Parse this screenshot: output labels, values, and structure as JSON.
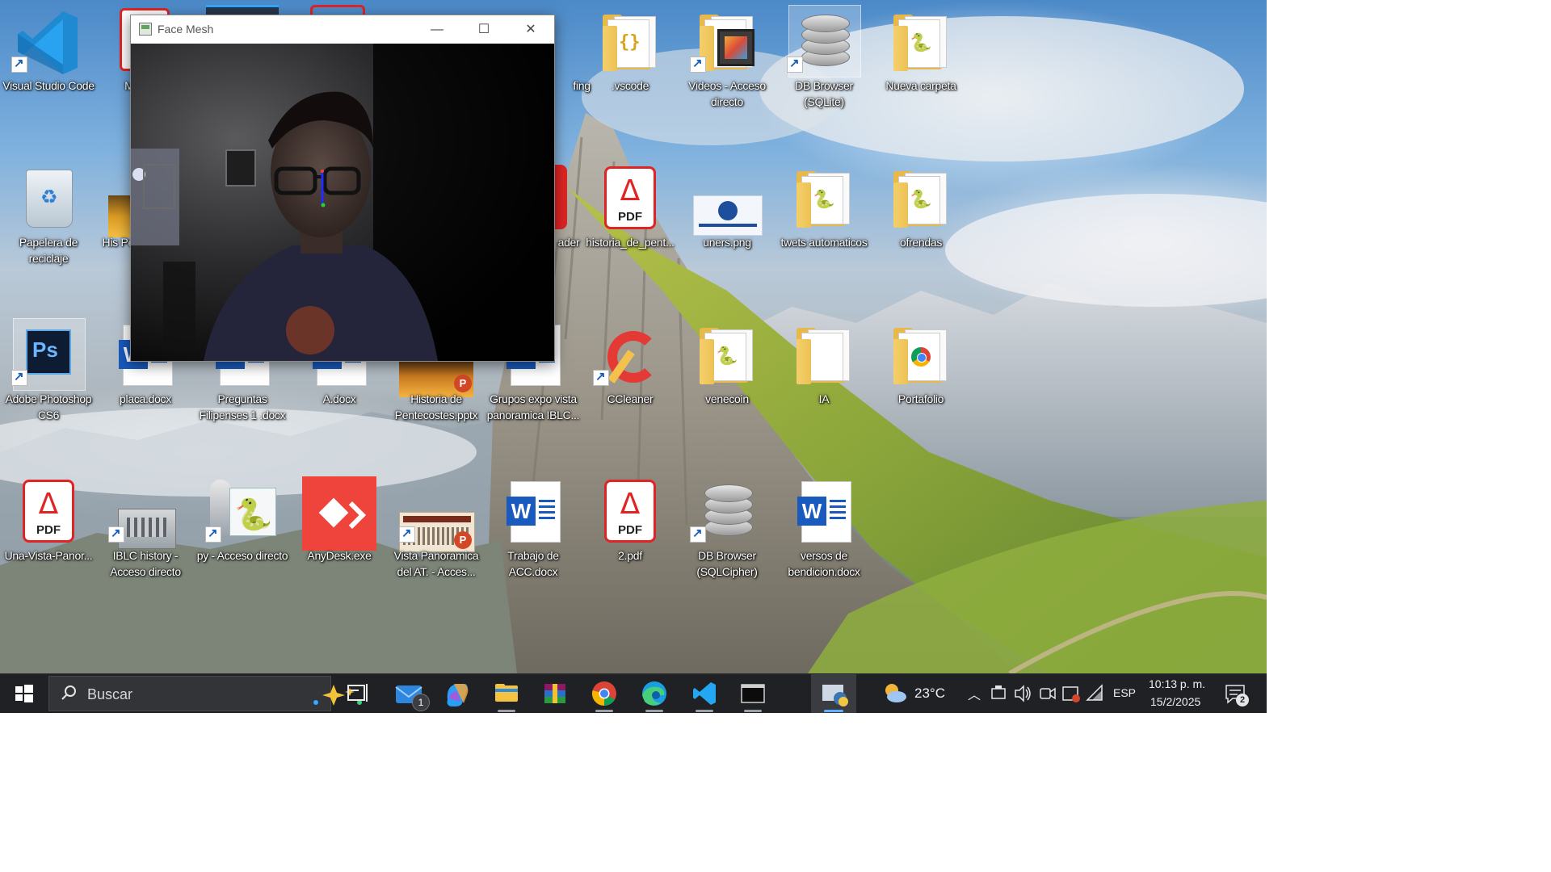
{
  "window": {
    "title": "Face Mesh",
    "minimize_glyph": "—",
    "maximize_glyph": "☐",
    "close_glyph": "✕"
  },
  "desktop": {
    "icons": [
      {
        "id": "vscode",
        "label": "Visual Studio Code",
        "icon": "vscode-icon"
      },
      {
        "id": "me-fam",
        "label": "ME FAM",
        "icon": "document-icon"
      },
      {
        "id": "vscode-folder",
        "label": ".vscode",
        "icon": "folder-icon"
      },
      {
        "id": "videos",
        "label": "Videos - Acceso directo",
        "icon": "video-folder-icon"
      },
      {
        "id": "db-browser-sqlite",
        "label": "DB Browser (SQLite)",
        "icon": "database-icon"
      },
      {
        "id": "nueva-carpeta",
        "label": "Nueva carpeta",
        "icon": "folder-icon"
      },
      {
        "id": "papelera",
        "label": "Papelera de reciclaje",
        "icon": "recycle-bin-icon"
      },
      {
        "id": "historia-pen",
        "label": "His Pen",
        "icon": "image-icon"
      },
      {
        "id": "reader",
        "label": "ader",
        "icon": "pdf-reader-icon"
      },
      {
        "id": "historia-pent-pdf",
        "label": "historia_de_pent...",
        "icon": "pdf-icon"
      },
      {
        "id": "uners",
        "label": "uners.png",
        "icon": "image-icon"
      },
      {
        "id": "twets",
        "label": "twets automaticos",
        "icon": "folder-icon"
      },
      {
        "id": "ofrendas",
        "label": "ofrendas",
        "icon": "folder-icon"
      },
      {
        "id": "photoshop",
        "label": "Adobe Photoshop CS6",
        "icon": "photoshop-icon"
      },
      {
        "id": "placa",
        "label": "placa.docx",
        "icon": "word-icon"
      },
      {
        "id": "preguntas",
        "label": "Preguntas Filipenses 1 .docx",
        "icon": "word-icon"
      },
      {
        "id": "a-docx",
        "label": "A.docx",
        "icon": "word-icon"
      },
      {
        "id": "historia-pptx",
        "label": "Historia de Pentecostes.pptx",
        "icon": "powerpoint-icon"
      },
      {
        "id": "grupos",
        "label": "Grupos expo vista panoramica IBLC...",
        "icon": "word-icon"
      },
      {
        "id": "ccleaner",
        "label": "CCleaner",
        "icon": "ccleaner-icon"
      },
      {
        "id": "venecoin",
        "label": "venecoin",
        "icon": "folder-icon"
      },
      {
        "id": "ia",
        "label": "IA",
        "icon": "folder-icon"
      },
      {
        "id": "portafolio",
        "label": "Portafolio",
        "icon": "chrome-folder-icon"
      },
      {
        "id": "una-vista",
        "label": "Una-Vista-Panor...",
        "icon": "pdf-icon"
      },
      {
        "id": "iblc",
        "label": "IBLC history - Acceso directo",
        "icon": "image-icon"
      },
      {
        "id": "py",
        "label": "py - Acceso directo",
        "icon": "python-icon"
      },
      {
        "id": "anydesk",
        "label": "AnyDesk.exe",
        "icon": "anydesk-icon"
      },
      {
        "id": "vista-at",
        "label": "Vista Panoramica del AT. - Acces...",
        "icon": "powerpoint-icon"
      },
      {
        "id": "trabajo-acc",
        "label": "Trabajo de ACC.docx",
        "icon": "word-icon"
      },
      {
        "id": "two-pdf",
        "label": "2.pdf",
        "icon": "pdf-icon"
      },
      {
        "id": "db-browser-sqlcipher",
        "label": "DB Browser (SQLCipher)",
        "icon": "database-icon"
      },
      {
        "id": "versos",
        "label": "versos de bendicion.docx",
        "icon": "word-icon"
      },
      {
        "id": "fing",
        "label": "fing",
        "icon": "folder-icon"
      }
    ]
  },
  "taskbar": {
    "search_placeholder": "Buscar",
    "mail_badge": "1",
    "weather": "23°C",
    "language": "ESP",
    "time": "10:13 p. m.",
    "date": "15/2/2025",
    "notification_count": "2",
    "apps": [
      "task-view-icon",
      "mail-icon",
      "copilot-icon",
      "file-explorer-icon",
      "winrar-icon",
      "chrome-icon",
      "edge-icon",
      "vscode-icon",
      "terminal-icon",
      "python-icon"
    ]
  },
  "colors": {
    "taskbar_bg": "#1f2125",
    "search_bg": "#323438",
    "label_text": "#ffffff"
  }
}
